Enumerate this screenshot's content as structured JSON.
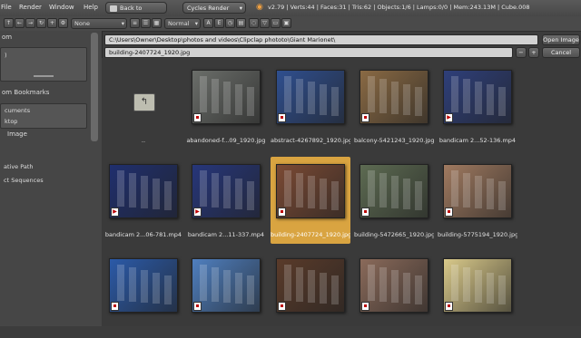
{
  "topbar": {
    "menus": [
      "File",
      "Render",
      "Window",
      "Help"
    ],
    "back_button": "Back to Previous",
    "render_engine": "Cycles Render",
    "stats": "v2.79 | Verts:44 | Faces:31 | Tris:62 | Objects:1/6 | Lamps:0/0 | Mem:243.13M | Cube.008"
  },
  "toolbar": {
    "filter_select": "None",
    "display_select": "Normal"
  },
  "left_panel": {
    "system_header": "om",
    "system_items": [
      ")"
    ],
    "bookmarks_header": "om Bookmarks",
    "bookmark_items": [
      "cuments",
      "ktop"
    ],
    "image_header": "Image",
    "options": [
      "ative Path",
      "ct Sequences"
    ]
  },
  "path_bar": {
    "directory": "C:\\Users\\Owner\\Desktop\\photos and videos\\Clipclap phototo\\Giant Marionet\\",
    "filename": "building-2407724_1920.jpg",
    "open_button": "Open Image",
    "cancel_button": "Cancel",
    "minus": "−",
    "plus": "+"
  },
  "files": [
    {
      "name": "..",
      "type": "parent"
    },
    {
      "name": "abandoned-f...09_1920.jpg",
      "type": "img",
      "color": "#6b6e6a"
    },
    {
      "name": "abstract-4267892_1920.jpg",
      "type": "img",
      "color": "#2f4f8f"
    },
    {
      "name": "balcony-5421243_1920.jpg",
      "type": "img",
      "color": "#8a6a44"
    },
    {
      "name": "bandicam 2...52-136.mp4",
      "type": "vid",
      "color": "#2e3f7a"
    },
    {
      "name": "bandicam 2...06-781.mp4",
      "type": "vid",
      "color": "#1f2f6e"
    },
    {
      "name": "bandicam 2...11-337.mp4",
      "type": "vid",
      "color": "#26367a"
    },
    {
      "name": "building-2407724_1920.jpg",
      "type": "img",
      "color": "#7b4a34",
      "selected": true
    },
    {
      "name": "building-5472665_1920.jpg",
      "type": "img",
      "color": "#5d6b52"
    },
    {
      "name": "building-5775194_1920.jpg",
      "type": "img",
      "color": "#a07a60"
    },
    {
      "name": "",
      "type": "img",
      "color": "#2b5aa8"
    },
    {
      "name": "",
      "type": "img",
      "color": "#4f7fbf"
    },
    {
      "name": "",
      "type": "img",
      "color": "#5a3b2a"
    },
    {
      "name": "",
      "type": "img",
      "color": "#8a6a5a"
    },
    {
      "name": "",
      "type": "img",
      "color": "#d9c98a"
    }
  ]
}
